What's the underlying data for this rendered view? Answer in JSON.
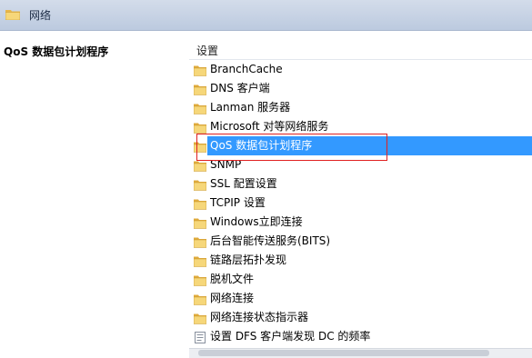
{
  "header": {
    "title": "网络",
    "icon": "folder-icon"
  },
  "left_pane": {
    "title": "QoS 数据包计划程序"
  },
  "column_header": "设置",
  "rows": [
    {
      "label": "BranchCache",
      "icon": "folder-icon"
    },
    {
      "label": "DNS 客户端",
      "icon": "folder-icon"
    },
    {
      "label": "Lanman 服务器",
      "icon": "folder-icon"
    },
    {
      "label": "Microsoft 对等网络服务",
      "icon": "folder-icon"
    },
    {
      "label": "QoS 数据包计划程序",
      "icon": "folder-icon",
      "selected": true
    },
    {
      "label": "SNMP",
      "icon": "folder-icon"
    },
    {
      "label": "SSL 配置设置",
      "icon": "folder-icon"
    },
    {
      "label": "TCPIP 设置",
      "icon": "folder-icon"
    },
    {
      "label": "Windows立即连接",
      "icon": "folder-icon"
    },
    {
      "label": "后台智能传送服务(BITS)",
      "icon": "folder-icon"
    },
    {
      "label": "链路层拓扑发现",
      "icon": "folder-icon"
    },
    {
      "label": "脱机文件",
      "icon": "folder-icon"
    },
    {
      "label": "网络连接",
      "icon": "folder-icon"
    },
    {
      "label": "网络连接状态指示器",
      "icon": "folder-icon"
    },
    {
      "label": "设置 DFS 客户端发现 DC 的频率",
      "icon": "policy-setting-icon"
    }
  ],
  "colors": {
    "selection": "#3399ff",
    "highlight_border": "#e02020",
    "folder": "#f3c95a"
  }
}
